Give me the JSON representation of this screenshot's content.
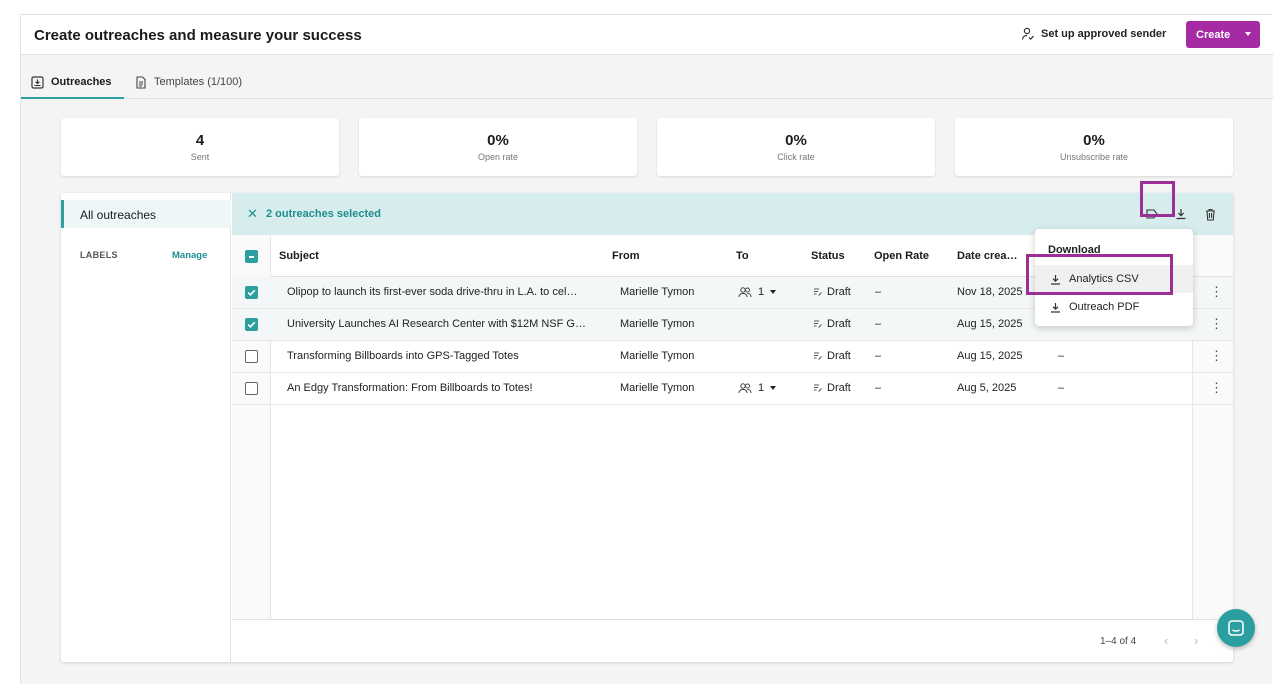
{
  "header": {
    "title": "Create outreaches and measure your success",
    "sender_label": "Set up approved sender",
    "create_label": "Create"
  },
  "tabs": [
    {
      "label": "Outreaches",
      "active": true,
      "icon": "outreach-icon"
    },
    {
      "label": "Templates (1/100)",
      "active": false,
      "icon": "document-icon"
    }
  ],
  "stats": [
    {
      "value": "4",
      "label": "Sent"
    },
    {
      "value": "0%",
      "label": "Open rate"
    },
    {
      "value": "0%",
      "label": "Click rate"
    },
    {
      "value": "0%",
      "label": "Unsubscribe rate"
    }
  ],
  "sidebar": {
    "all_label": "All outreaches",
    "labels_heading": "LABELS",
    "manage_label": "Manage"
  },
  "selection": {
    "text": "2 outreaches selected"
  },
  "table": {
    "columns": [
      "Subject",
      "From",
      "To",
      "Status",
      "Open Rate",
      "Date crea…"
    ],
    "rows": [
      {
        "subject": "Olipop to launch its first-ever soda drive-thru in L.A. to cel…",
        "from": "Marielle Tymon",
        "to": "1",
        "status": "Draft",
        "open_rate": "–",
        "date": "Nov 18, 2025",
        "extra": "",
        "checked": true
      },
      {
        "subject": "University Launches AI Research Center with $12M NSF G…",
        "from": "Marielle Tymon",
        "to": "",
        "status": "Draft",
        "open_rate": "–",
        "date": "Aug 15, 2025",
        "extra": "",
        "checked": true
      },
      {
        "subject": "Transforming Billboards into GPS-Tagged Totes",
        "from": "Marielle Tymon",
        "to": "",
        "status": "Draft",
        "open_rate": "–",
        "date": "Aug 15, 2025",
        "extra": "–",
        "checked": false
      },
      {
        "subject": "An Edgy Transformation: From Billboards to Totes!",
        "from": "Marielle Tymon",
        "to": "1",
        "status": "Draft",
        "open_rate": "–",
        "date": "Aug 5, 2025",
        "extra": "–",
        "checked": false
      }
    ]
  },
  "pagination": {
    "text": "1–4 of 4"
  },
  "dropdown": {
    "heading": "Download",
    "items": [
      "Analytics CSV",
      "Outreach PDF"
    ]
  },
  "colors": {
    "accent": "#2e9fa0",
    "brand": "#a62aa3",
    "highlight": "#9c2f96"
  }
}
